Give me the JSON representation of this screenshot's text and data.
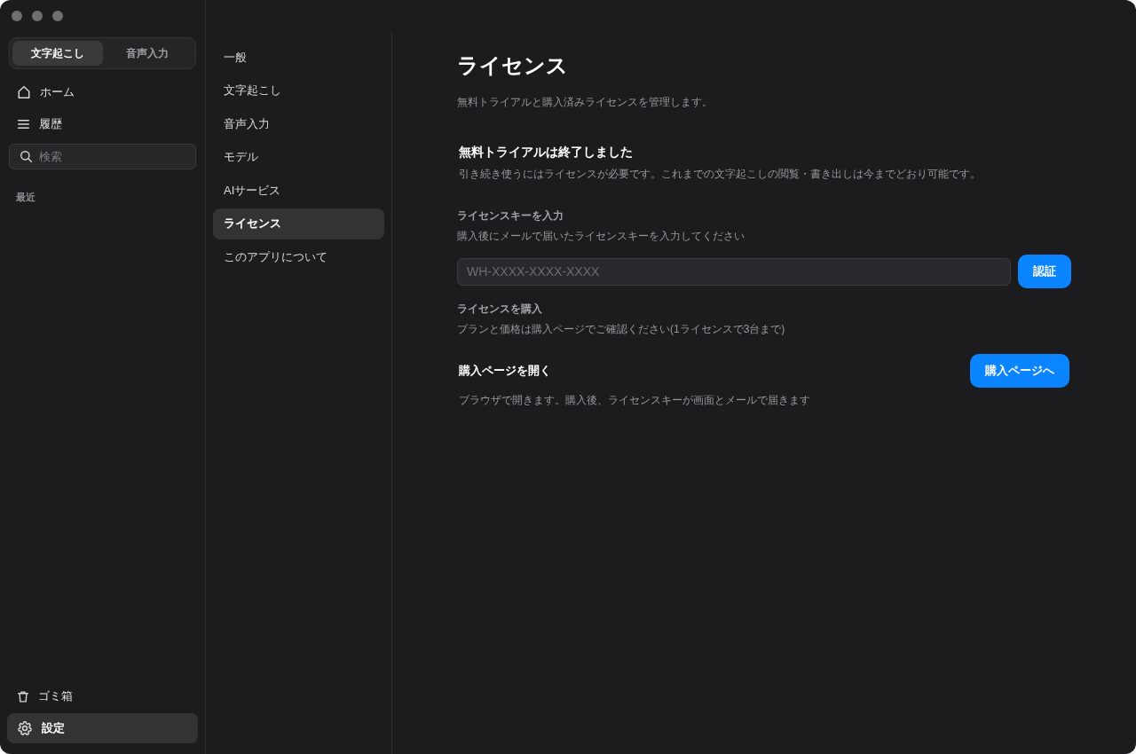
{
  "sidebar": {
    "mode_tabs": [
      {
        "label": "文字起こし",
        "selected": true
      },
      {
        "label": "音声入力",
        "selected": false
      }
    ],
    "nav_items": [
      {
        "label": "ホーム",
        "selected": false
      },
      {
        "label": "履歴",
        "selected": false
      }
    ],
    "search": {
      "placeholder": "検索"
    },
    "recent_heading": "最近",
    "bottom_items": [
      {
        "label": "ゴミ箱",
        "selected": false
      },
      {
        "label": "設定",
        "selected": true
      }
    ]
  },
  "settings_nav": {
    "items": [
      {
        "label": "一般",
        "selected": false
      },
      {
        "label": "文字起こし",
        "selected": false
      },
      {
        "label": "音声入力",
        "selected": false
      },
      {
        "label": "モデル",
        "selected": false
      },
      {
        "label": "AIサービス",
        "selected": false
      },
      {
        "label": "ライセンス",
        "selected": true
      },
      {
        "label": "このアプリについて",
        "selected": false
      }
    ]
  },
  "content": {
    "title": "ライセンス",
    "subtitle": "無料トライアルと購入済みライセンスを管理します。",
    "notice": {
      "title": "無料トライアルは終了しました",
      "text": "引き続き使うにはライセンスが必要です。これまでの文字起こしの閲覧・書き出しは今までどおり可能です。"
    },
    "license_key": {
      "label": "ライセンスキーを入力",
      "hint": "購入後にメールで届いたライセンスキーを入力してください",
      "field": {
        "placeholder": "WH-XXXX-XXXX-XXXX"
      },
      "button": "認証"
    },
    "purchase": {
      "label": "ライセンスを購入",
      "hint": "プランと価格は購入ページでご確認ください(1ライセンスで3台まで)",
      "action": {
        "title": "購入ページを開く",
        "button": "購入ページへ",
        "text": "ブラウザで開きます。購入後、ライセンスキーが画面とメールで届きます"
      }
    }
  }
}
